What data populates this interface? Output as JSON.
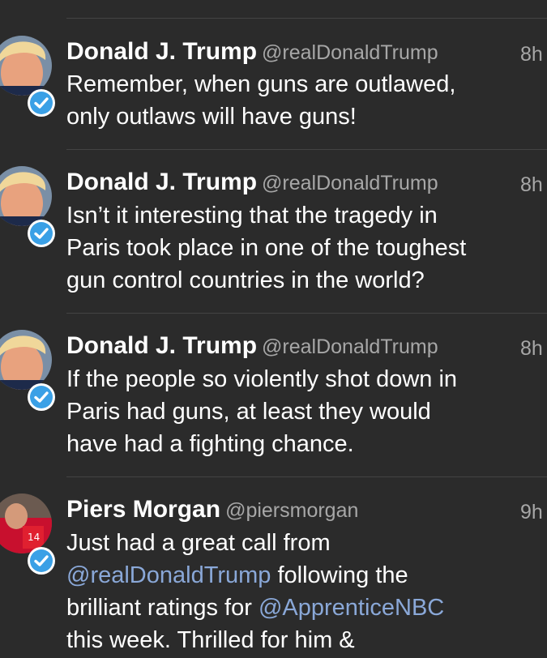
{
  "colors": {
    "background": "#2b2b2b",
    "text": "#ffffff",
    "secondary": "#a7a7a7",
    "link": "#8aa8d8",
    "verified": "#3aa0e6"
  },
  "tweets": [
    {
      "name": "Donald J. Trump",
      "handle": "@realDonaldTrump",
      "time": "8h",
      "text": "Remember, when guns are outlawed,\nonly outlaws will have guns!",
      "avatar": "trump-avatar",
      "verified_icon": "verified-badge-icon"
    },
    {
      "name": "Donald J. Trump",
      "handle": "@realDonaldTrump",
      "time": "8h",
      "text": "Isn’t it interesting that the tragedy in\nParis took place in one of the toughest\ngun control countries in the world?",
      "avatar": "trump-avatar",
      "verified_icon": "verified-badge-icon"
    },
    {
      "name": "Donald J. Trump",
      "handle": "@realDonaldTrump",
      "time": "8h",
      "text": "If the people so violently shot down in\nParis had guns, at least they would\nhave had a fighting chance.",
      "avatar": "trump-avatar",
      "verified_icon": "verified-badge-icon"
    },
    {
      "name": "Piers Morgan",
      "handle": "@piersmorgan",
      "time": "9h",
      "text_parts": [
        "Just had a great call from\n",
        "@realDonaldTrump",
        " following the\nbrilliant ratings for ",
        "@ApprenticeNBC",
        "\nthis week. Thrilled for him &"
      ],
      "avatar": "piers-avatar",
      "verified_icon": "verified-badge-icon"
    }
  ]
}
